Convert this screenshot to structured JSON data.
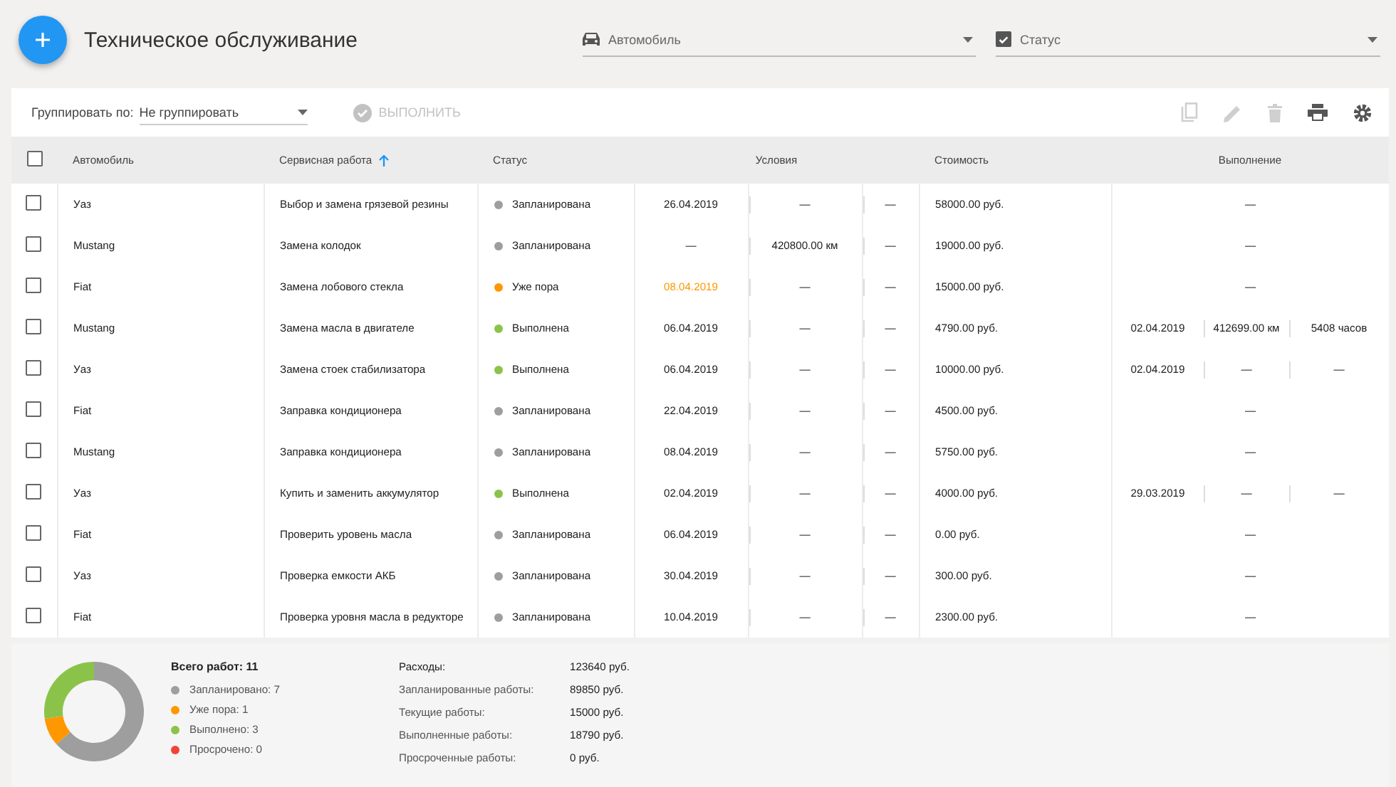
{
  "header": {
    "title": "Техническое обслуживание",
    "filters": [
      {
        "kind": "car",
        "label": "Автомобиль"
      },
      {
        "kind": "checkbox",
        "label": "Статус",
        "checked": true
      }
    ]
  },
  "toolbar": {
    "group_label": "Группировать по:",
    "group_value": "Не группировать",
    "execute": {
      "label": "ВЫПОЛНИТЬ",
      "disabled": true
    },
    "actions": [
      {
        "kind": "copy",
        "disabled": true
      },
      {
        "kind": "edit",
        "disabled": true
      },
      {
        "kind": "delete",
        "disabled": true
      },
      {
        "kind": "print",
        "disabled": false
      },
      {
        "kind": "settings",
        "disabled": false
      }
    ]
  },
  "table": {
    "select_all": false,
    "columns": [
      {
        "label": "Автомобиль",
        "kind": "single",
        "sorted": false
      },
      {
        "label": "Сервисная работа",
        "kind": "single",
        "sorted": true
      },
      {
        "label": "Статус",
        "kind": "single",
        "sorted": false
      },
      {
        "label": "Условия",
        "kind": "group",
        "sorted": false
      },
      {
        "label": "Стоимость",
        "kind": "single",
        "sorted": false
      },
      {
        "label": "Выполнение",
        "kind": "group",
        "sorted": false
      }
    ],
    "rows": [
      {
        "checked": false,
        "car": "Уаз",
        "work": "Выбор и замена грязевой резины",
        "status": "Запланирована",
        "color": "#9e9e9e",
        "conditions": [
          "26.04.2019",
          "—",
          "—"
        ],
        "date_overdue": false,
        "cost": "58000.00 руб.",
        "execution": [
          "—"
        ]
      },
      {
        "checked": false,
        "car": "Mustang",
        "work": "Замена колодок",
        "status": "Запланирована",
        "color": "#9e9e9e",
        "conditions": [
          "—",
          "420800.00 км",
          "—"
        ],
        "date_overdue": false,
        "cost": "19000.00 руб.",
        "execution": [
          "—"
        ]
      },
      {
        "checked": false,
        "car": "Fiat",
        "work": "Замена лобового стекла",
        "status": "Уже пора",
        "color": "#ff9800",
        "conditions": [
          "08.04.2019",
          "—",
          "—"
        ],
        "date_overdue": true,
        "cost": "15000.00 руб.",
        "execution": [
          "—"
        ]
      },
      {
        "checked": false,
        "car": "Mustang",
        "work": "Замена масла в двигателе",
        "status": "Выполнена",
        "color": "#8bc34a",
        "conditions": [
          "06.04.2019",
          "—",
          "—"
        ],
        "date_overdue": false,
        "cost": "4790.00 руб.",
        "execution": [
          "02.04.2019",
          "412699.00 км",
          "5408 часов"
        ]
      },
      {
        "checked": false,
        "car": "Уаз",
        "work": "Замена стоек стабилизатора",
        "status": "Выполнена",
        "color": "#8bc34a",
        "conditions": [
          "06.04.2019",
          "—",
          "—"
        ],
        "date_overdue": false,
        "cost": "10000.00 руб.",
        "execution": [
          "02.04.2019",
          "—",
          "—"
        ]
      },
      {
        "checked": false,
        "car": "Fiat",
        "work": "Заправка кондиционера",
        "status": "Запланирована",
        "color": "#9e9e9e",
        "conditions": [
          "22.04.2019",
          "—",
          "—"
        ],
        "date_overdue": false,
        "cost": "4500.00 руб.",
        "execution": [
          "—"
        ]
      },
      {
        "checked": false,
        "car": "Mustang",
        "work": "Заправка кондиционера",
        "status": "Запланирована",
        "color": "#9e9e9e",
        "conditions": [
          "08.04.2019",
          "—",
          "—"
        ],
        "date_overdue": false,
        "cost": "5750.00 руб.",
        "execution": [
          "—"
        ]
      },
      {
        "checked": false,
        "car": "Уаз",
        "work": "Купить и заменить аккумулятор",
        "status": "Выполнена",
        "color": "#8bc34a",
        "conditions": [
          "02.04.2019",
          "—",
          "—"
        ],
        "date_overdue": false,
        "cost": "4000.00 руб.",
        "execution": [
          "29.03.2019",
          "—",
          "—"
        ]
      },
      {
        "checked": false,
        "car": "Fiat",
        "work": "Проверить уровень масла",
        "status": "Запланирована",
        "color": "#9e9e9e",
        "conditions": [
          "06.04.2019",
          "—",
          "—"
        ],
        "date_overdue": false,
        "cost": "0.00 руб.",
        "execution": [
          "—"
        ]
      },
      {
        "checked": false,
        "car": "Уаз",
        "work": "Проверка емкости АКБ",
        "status": "Запланирована",
        "color": "#9e9e9e",
        "conditions": [
          "30.04.2019",
          "—",
          "—"
        ],
        "date_overdue": false,
        "cost": "300.00 руб.",
        "execution": [
          "—"
        ]
      },
      {
        "checked": false,
        "car": "Fiat",
        "work": "Проверка уровня масла в редукторе",
        "status": "Запланирована",
        "color": "#9e9e9e",
        "conditions": [
          "10.04.2019",
          "—",
          "—"
        ],
        "date_overdue": false,
        "cost": "2300.00 руб.",
        "execution": [
          "—"
        ]
      }
    ]
  },
  "summary": {
    "total": "Всего работ: 11",
    "legend": [
      {
        "label": "Запланировано: 7",
        "color": "#9e9e9e"
      },
      {
        "label": "Уже пора: 1",
        "color": "#ff9800"
      },
      {
        "label": "Выполнено: 3",
        "color": "#8bc34a"
      },
      {
        "label": "Просрочено: 0",
        "color": "#f44336"
      }
    ],
    "chart_data": {
      "type": "donut",
      "values": [
        63.64,
        9.09,
        27.27,
        0
      ]
    },
    "expenses": [
      {
        "label": "Расходы:",
        "value": "123640 руб."
      },
      {
        "label": "Запланированные работы:",
        "value": "89850 руб."
      },
      {
        "label": "Текущие работы:",
        "value": "15000 руб."
      },
      {
        "label": "Выполненные работы:",
        "value": "18790 руб."
      },
      {
        "label": "Просроченные работы:",
        "value": "0 руб."
      }
    ]
  }
}
